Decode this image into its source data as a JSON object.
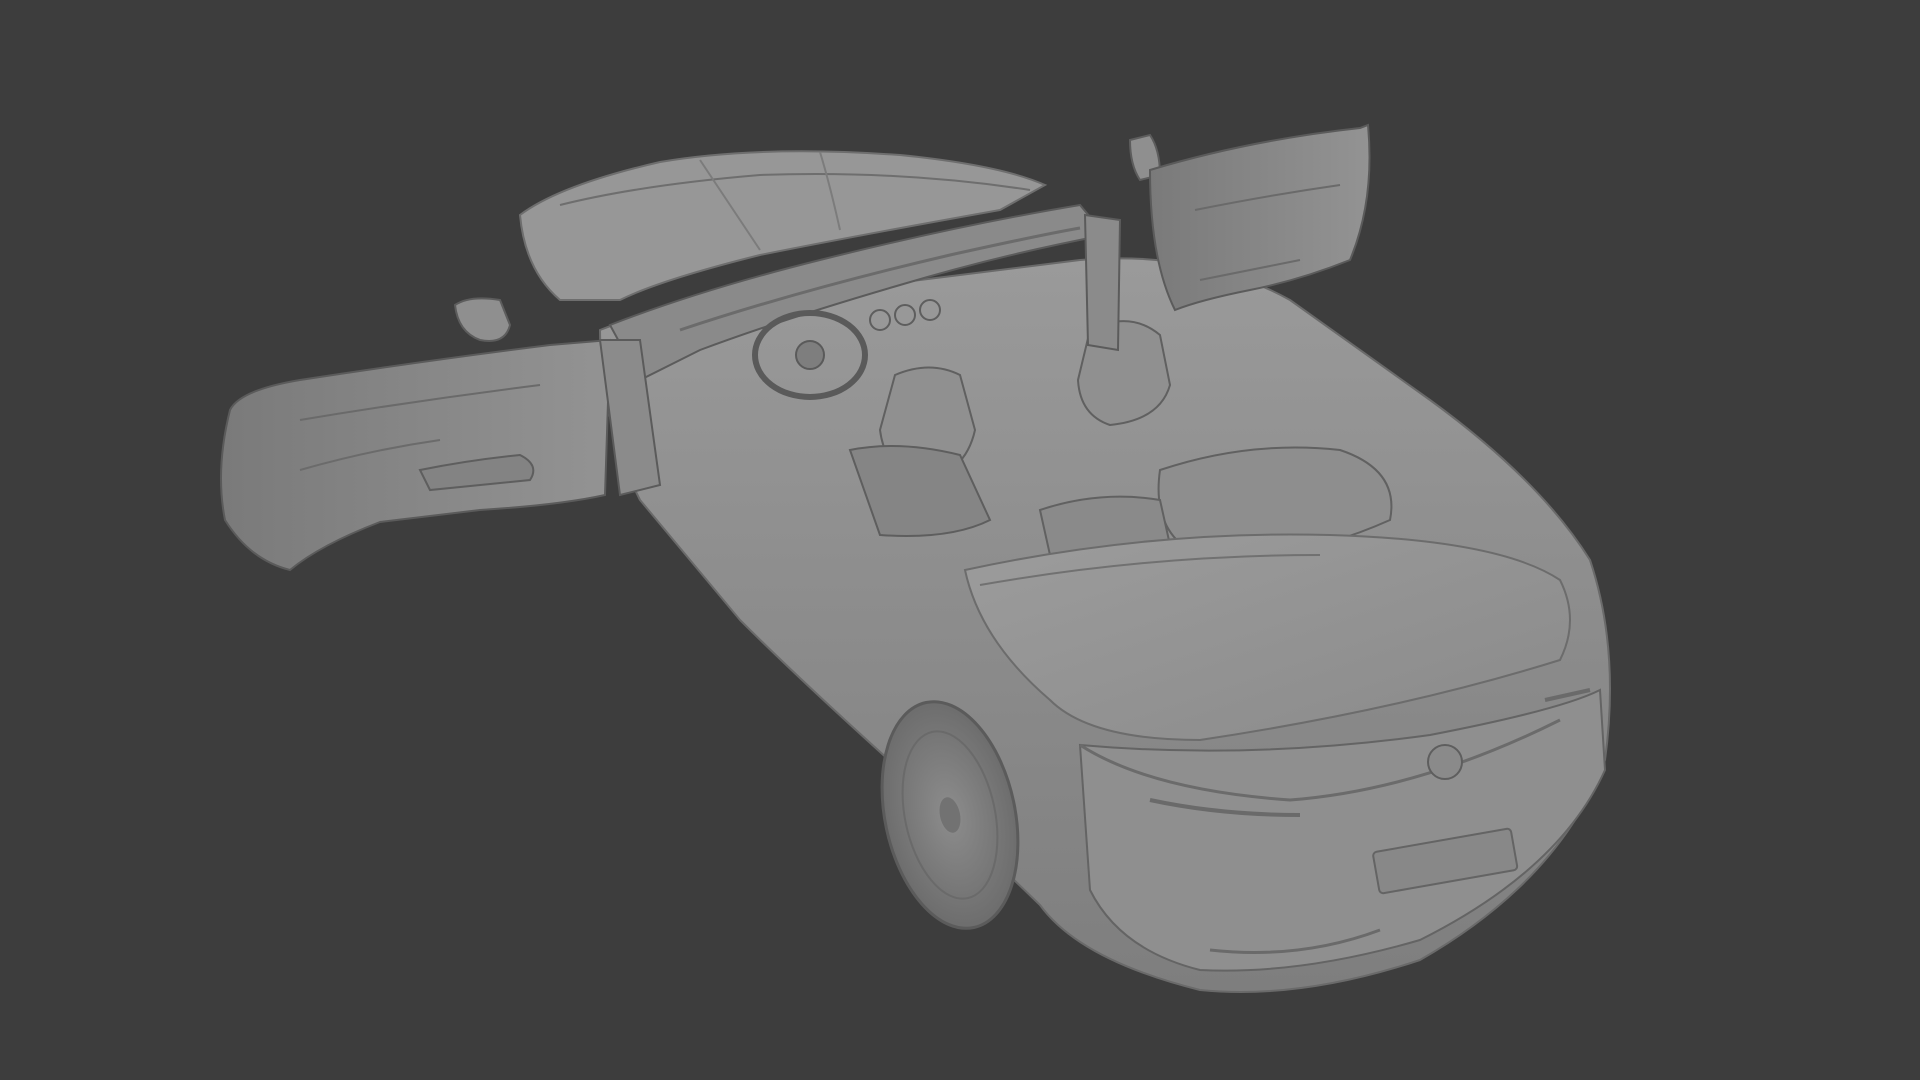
{
  "viewport": {
    "background_color": "#3d3d3d",
    "model_color": "#8a8a8a",
    "model_name": "",
    "shading": "solid"
  }
}
